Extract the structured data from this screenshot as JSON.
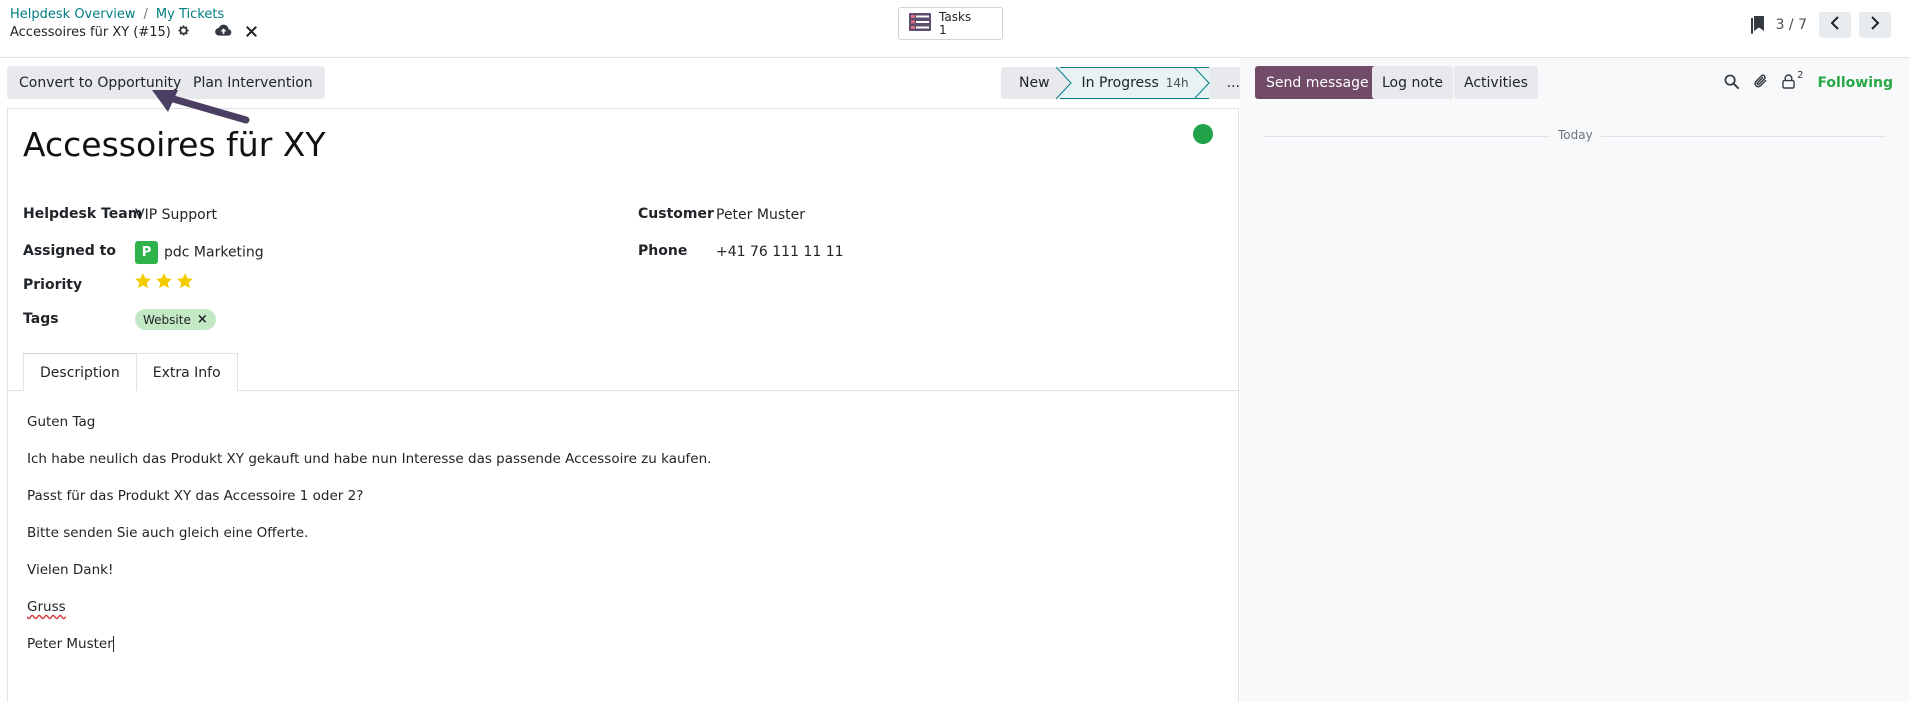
{
  "breadcrumb": {
    "items": [
      "Helpdesk Overview",
      "My Tickets"
    ],
    "separator": "/"
  },
  "record": {
    "title": "Accessoires für XY (#15)"
  },
  "smart_button": {
    "label": "Tasks",
    "count": "1"
  },
  "pager": {
    "value": "3 / 7"
  },
  "actions": {
    "convert_label": "Convert to Opportunity",
    "plan_label": "Plan Intervention"
  },
  "stages": {
    "new": "New",
    "in_progress": "In Progress",
    "in_progress_duration": "14h",
    "more": "..."
  },
  "ticket": {
    "name": "Accessoires für XY",
    "helpdesk_team_label": "Helpdesk Team",
    "helpdesk_team": "VIP Support",
    "assigned_label": "Assigned to",
    "assigned_initial": "P",
    "assigned_to": "pdc Marketing",
    "priority_label": "Priority",
    "priority": 3,
    "tags_label": "Tags",
    "tag": "Website",
    "customer_label": "Customer",
    "customer": "Peter Muster",
    "phone_label": "Phone",
    "phone": "+41 76 111 11 11"
  },
  "tabs": {
    "description": "Description",
    "extra_info": "Extra Info"
  },
  "description": {
    "line1": "Guten Tag",
    "line2": "Ich habe neulich das Produkt XY gekauft und habe nun Interesse das passende Accessoire zu kaufen.",
    "line3": "Passt für das Produkt XY das Accessoire 1 oder 2?",
    "line4": "Bitte senden Sie auch gleich eine Offerte.",
    "line5": "Vielen Dank!",
    "line6": "Gruss",
    "line7": "Peter Muster"
  },
  "chatter": {
    "send_message": "Send message",
    "log_note": "Log note",
    "activities": "Activities",
    "followers_count": "2",
    "following": "Following",
    "today": "Today"
  },
  "colors": {
    "primary": "#714b67",
    "link": "#017e84",
    "success": "#21a34a",
    "tag_bg": "#c2e8c4",
    "star": "#f3cc00"
  }
}
